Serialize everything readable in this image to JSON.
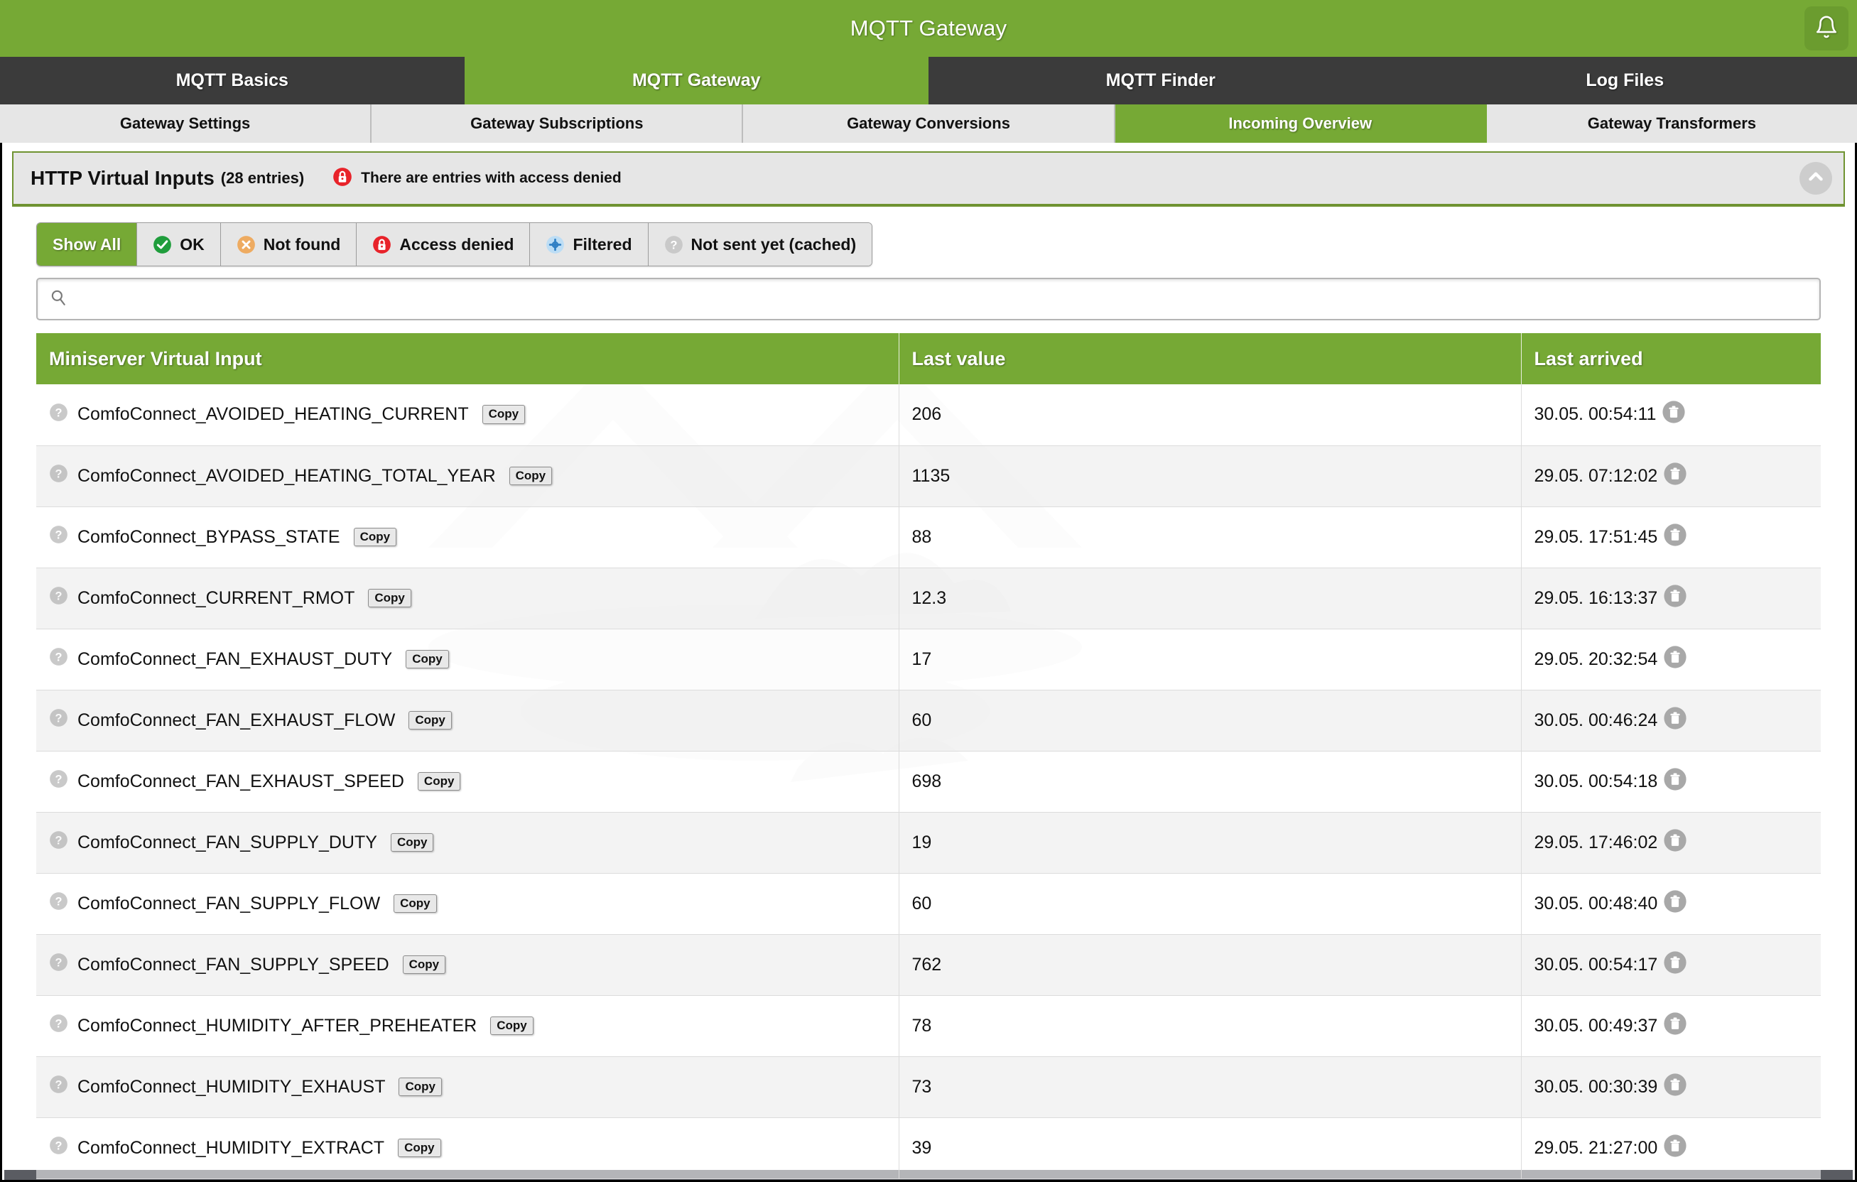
{
  "titlebar": {
    "title": "MQTT Gateway",
    "bell_icon": "bell-icon"
  },
  "main_tabs": [
    {
      "label": "MQTT Basics",
      "active": false
    },
    {
      "label": "MQTT Gateway",
      "active": true
    },
    {
      "label": "MQTT Finder",
      "active": false
    },
    {
      "label": "Log Files",
      "active": false
    }
  ],
  "sub_tabs": [
    {
      "label": "Gateway Settings",
      "active": false
    },
    {
      "label": "Gateway Subscriptions",
      "active": false
    },
    {
      "label": "Gateway Conversions",
      "active": false
    },
    {
      "label": "Incoming Overview",
      "active": true
    },
    {
      "label": "Gateway Transformers",
      "active": false
    }
  ],
  "panel": {
    "title": "HTTP Virtual Inputs",
    "count": "(28 entries)",
    "warning": "There are entries with access denied",
    "warning_icon": "lock-icon",
    "collapse_icon": "chevron-up-icon"
  },
  "filters": [
    {
      "label": "Show All",
      "icon": "none",
      "active": true
    },
    {
      "label": "OK",
      "icon": "check-circle-icon",
      "active": false
    },
    {
      "label": "Not found",
      "icon": "x-circle-icon",
      "active": false
    },
    {
      "label": "Access denied",
      "icon": "lock-icon",
      "active": false
    },
    {
      "label": "Filtered",
      "icon": "filter-circle-icon",
      "active": false
    },
    {
      "label": "Not sent yet (cached)",
      "icon": "question-circle-icon",
      "active": false
    }
  ],
  "search": {
    "value": "",
    "placeholder": "",
    "icon": "search-icon"
  },
  "table": {
    "columns": [
      "Miniserver Virtual Input",
      "Last value",
      "Last arrived"
    ],
    "row_status_icon": "question-circle-icon",
    "copy_label": "Copy",
    "delete_icon": "trash-icon",
    "rows": [
      {
        "name": "ComfoConnect_AVOIDED_HEATING_CURRENT",
        "value": "206",
        "arrived": "30.05. 00:54:11"
      },
      {
        "name": "ComfoConnect_AVOIDED_HEATING_TOTAL_YEAR",
        "value": "1135",
        "arrived": "29.05. 07:12:02"
      },
      {
        "name": "ComfoConnect_BYPASS_STATE",
        "value": "88",
        "arrived": "29.05. 17:51:45"
      },
      {
        "name": "ComfoConnect_CURRENT_RMOT",
        "value": "12.3",
        "arrived": "29.05. 16:13:37"
      },
      {
        "name": "ComfoConnect_FAN_EXHAUST_DUTY",
        "value": "17",
        "arrived": "29.05. 20:32:54"
      },
      {
        "name": "ComfoConnect_FAN_EXHAUST_FLOW",
        "value": "60",
        "arrived": "30.05. 00:46:24"
      },
      {
        "name": "ComfoConnect_FAN_EXHAUST_SPEED",
        "value": "698",
        "arrived": "30.05. 00:54:18"
      },
      {
        "name": "ComfoConnect_FAN_SUPPLY_DUTY",
        "value": "19",
        "arrived": "29.05. 17:46:02"
      },
      {
        "name": "ComfoConnect_FAN_SUPPLY_FLOW",
        "value": "60",
        "arrived": "30.05. 00:48:40"
      },
      {
        "name": "ComfoConnect_FAN_SUPPLY_SPEED",
        "value": "762",
        "arrived": "30.05. 00:54:17"
      },
      {
        "name": "ComfoConnect_HUMIDITY_AFTER_PREHEATER",
        "value": "78",
        "arrived": "30.05. 00:49:37"
      },
      {
        "name": "ComfoConnect_HUMIDITY_EXHAUST",
        "value": "73",
        "arrived": "30.05. 00:30:39"
      },
      {
        "name": "ComfoConnect_HUMIDITY_EXTRACT",
        "value": "39",
        "arrived": "29.05. 21:27:00"
      }
    ]
  },
  "colors": {
    "brand_green": "#76a935",
    "dark_bar": "#3b3b3b",
    "subtab_bg": "#e6e6e6",
    "danger_red": "#e8232a",
    "warn_orange": "#eeab61",
    "info_blue": "#7fbfe8",
    "neutral_grey": "#b5b5b5"
  }
}
